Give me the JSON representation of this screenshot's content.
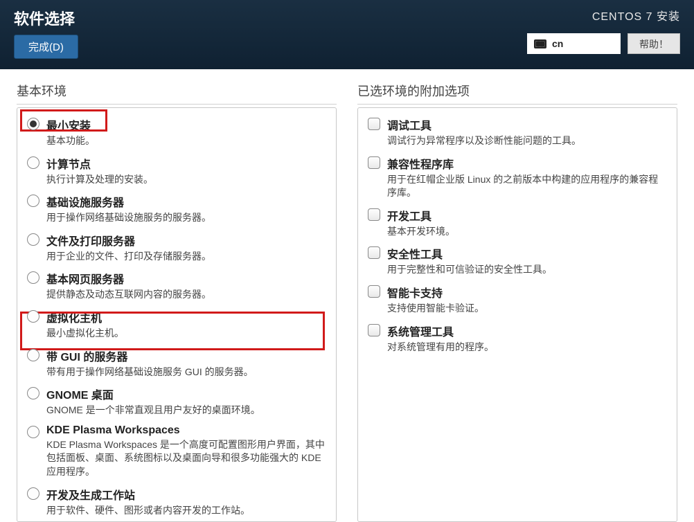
{
  "header": {
    "title": "软件选择",
    "done_label": "完成(D)",
    "install_title": "CENTOS 7 安装",
    "lang": "cn",
    "help_label": "帮助！"
  },
  "left": {
    "heading": "基本环境",
    "options": [
      {
        "title": "最小安装",
        "desc": "基本功能。",
        "selected": true
      },
      {
        "title": "计算节点",
        "desc": "执行计算及处理的安装。",
        "selected": false
      },
      {
        "title": "基础设施服务器",
        "desc": "用于操作网络基础设施服务的服务器。",
        "selected": false
      },
      {
        "title": "文件及打印服务器",
        "desc": "用于企业的文件、打印及存储服务器。",
        "selected": false
      },
      {
        "title": "基本网页服务器",
        "desc": "提供静态及动态互联网内容的服务器。",
        "selected": false
      },
      {
        "title": "虚拟化主机",
        "desc": "最小虚拟化主机。",
        "selected": false
      },
      {
        "title": "带 GUI 的服务器",
        "desc": "带有用于操作网络基础设施服务 GUI 的服务器。",
        "selected": false
      },
      {
        "title": "GNOME 桌面",
        "desc": "GNOME 是一个非常直观且用户友好的桌面环境。",
        "selected": false
      },
      {
        "title": "KDE Plasma Workspaces",
        "desc": "KDE Plasma Workspaces 是一个高度可配置图形用户界面，其中包括面板、桌面、系统图标以及桌面向导和很多功能强大的 KDE 应用程序。",
        "selected": false
      },
      {
        "title": "开发及生成工作站",
        "desc": "用于软件、硬件、图形或者内容开发的工作站。",
        "selected": false
      }
    ]
  },
  "right": {
    "heading": "已选环境的附加选项",
    "options": [
      {
        "title": "调试工具",
        "desc": "调试行为异常程序以及诊断性能问题的工具。"
      },
      {
        "title": "兼容性程序库",
        "desc": "用于在红帽企业版 Linux 的之前版本中构建的应用程序的兼容程序库。"
      },
      {
        "title": "开发工具",
        "desc": "基本开发环境。"
      },
      {
        "title": "安全性工具",
        "desc": "用于完整性和可信验证的安全性工具。"
      },
      {
        "title": "智能卡支持",
        "desc": "支持使用智能卡验证。"
      },
      {
        "title": "系统管理工具",
        "desc": "对系统管理有用的程序。"
      }
    ]
  }
}
